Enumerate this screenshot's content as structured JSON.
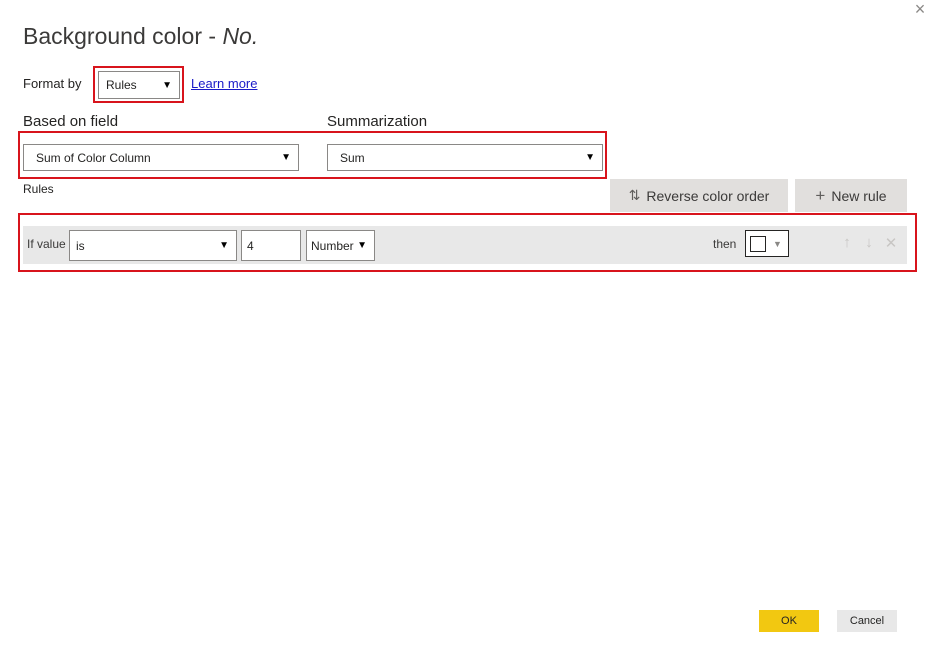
{
  "dialog": {
    "title_prefix": "Background color - ",
    "title_field": "No.",
    "close_icon": "×"
  },
  "format_by": {
    "label": "Format by",
    "value": "Rules",
    "learn_more": "Learn more"
  },
  "based_on_field": {
    "label": "Based on field",
    "value": "Sum of Color Column"
  },
  "summarization": {
    "label": "Summarization",
    "value": "Sum"
  },
  "rules": {
    "label": "Rules",
    "reverse_button": "Reverse color order",
    "new_rule_button": "New rule",
    "items": [
      {
        "if_label": "If value",
        "operator": "is",
        "value": "4",
        "value_type": "Number",
        "then_label": "then",
        "color": "#ffffff"
      }
    ]
  },
  "footer": {
    "ok": "OK",
    "cancel": "Cancel"
  },
  "colors": {
    "highlight_border": "#d8141c",
    "ok_button": "#f2c811",
    "link": "#1a1ac8"
  }
}
